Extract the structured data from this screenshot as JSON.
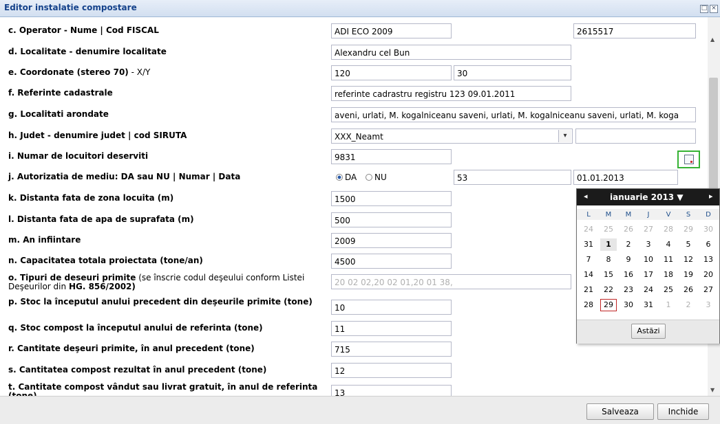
{
  "window": {
    "title": "Editor instalatie compostare"
  },
  "rows": {
    "c": {
      "label": "c. Operator - Nume | Cod FISCAL",
      "name": "ADI ECO 2009",
      "cod_fiscal": "2615517"
    },
    "d": {
      "label": "d. Localitate - denumire localitate",
      "value": "Alexandru cel Bun"
    },
    "e": {
      "label_bold": "e. Coordonate (stereo 70)",
      "label_rest": " - X/Y",
      "x": "120",
      "y": "30"
    },
    "f": {
      "label": "f. Referinte cadastrale",
      "value": "referinte cadrastru registru 123 09.01.2011"
    },
    "g": {
      "label": "g. Localitati arondate",
      "value": "aveni, urlati, M. kogalniceanu saveni, urlati, M. kogalniceanu saveni, urlati, M. koga"
    },
    "h": {
      "label": "h. Judet - denumire judet | cod SIRUTA",
      "judet": "XXX_Neamt",
      "siruta": ""
    },
    "i": {
      "label": "i. Numar de locuitori deserviti",
      "value": "9831"
    },
    "j": {
      "label": "j. Autorizatia de mediu: DA sau NU | Numar | Data",
      "opt_da": "DA",
      "opt_nu": "NU",
      "numar": "53",
      "data": "01.01.2013"
    },
    "k": {
      "label": "k. Distanta fata de zona locuita (m)",
      "value": "1500"
    },
    "l": {
      "label": "l. Distanta fata de apa de suprafata (m)",
      "value": "500"
    },
    "m": {
      "label": "m. An infiintare",
      "value": "2009"
    },
    "n": {
      "label": "n. Capacitatea totala proiectata (tone/an)",
      "value": "4500"
    },
    "o": {
      "label_bold": "o. Tipuri de deseuri primite",
      "label_mid": " (se înscrie codul deşeului conform Listei Deşeurilor din ",
      "label_bold2": "HG. 856/2002)",
      "value": "20 02 02,20 02 01,20 01 38,"
    },
    "p": {
      "label": "p. Stoc la începutul anului precedent din deşeurile primite (tone)",
      "value": "10"
    },
    "q": {
      "label": "q. Stoc compost la începutul anului de referinta (tone)",
      "value": "11"
    },
    "r": {
      "label": "r. Cantitate deşeuri primite, în anul precedent (tone)",
      "value": "715"
    },
    "s": {
      "label": "s. Cantitatea compost rezultat în anul precedent (tone)",
      "value": "12"
    },
    "t": {
      "label": "t. Cantitate compost vândut sau livrat gratuit, în anul de referinta (tone)",
      "value": "13"
    }
  },
  "calendar": {
    "month_title": "ianuarie 2013 ▼",
    "prev": "◂",
    "next": "▸",
    "dow": [
      "L",
      "M",
      "M",
      "J",
      "V",
      "S",
      "D"
    ],
    "weeks": [
      [
        "24",
        "25",
        "26",
        "27",
        "28",
        "29",
        "30"
      ],
      [
        "31",
        "1",
        "2",
        "3",
        "4",
        "5",
        "6"
      ],
      [
        "7",
        "8",
        "9",
        "10",
        "11",
        "12",
        "13"
      ],
      [
        "14",
        "15",
        "16",
        "17",
        "18",
        "19",
        "20"
      ],
      [
        "21",
        "22",
        "23",
        "24",
        "25",
        "26",
        "27"
      ],
      [
        "28",
        "29",
        "30",
        "31",
        "1",
        "2",
        "3"
      ]
    ],
    "today_label": "Astăzi",
    "selected_day": "1",
    "current_day": "29"
  },
  "footer": {
    "save_label": "Salveaza",
    "close_label": "Inchide"
  },
  "colors": {
    "accent": "#34b233",
    "calendar_header": "#1b1b1b",
    "title": "#15428b"
  }
}
